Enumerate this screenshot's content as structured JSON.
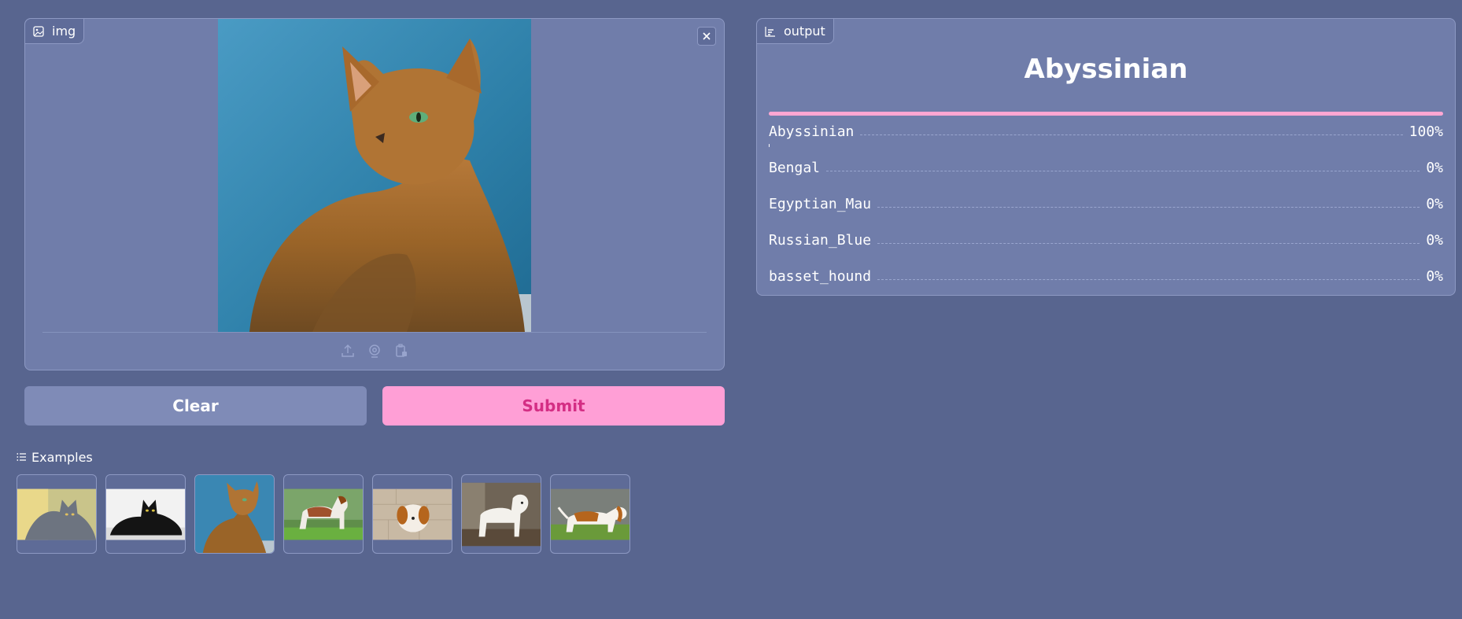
{
  "input": {
    "label": "img",
    "icon": "image-icon"
  },
  "buttons": {
    "clear": "Clear",
    "submit": "Submit"
  },
  "examples": {
    "label": "Examples",
    "items": [
      "russian-blue-cat-thumb",
      "black-cat-thumb",
      "abyssinian-cat-thumb",
      "saint-bernard-thumb",
      "shih-tzu-thumb",
      "white-dog-thumb",
      "basset-hound-thumb"
    ]
  },
  "output": {
    "label": "output",
    "title": "Abyssinian",
    "top_confidence": 1.0,
    "confidences": [
      {
        "label": "Abyssinian",
        "pct": "100%",
        "value": 1.0
      },
      {
        "label": "Bengal",
        "pct": "0%",
        "value": 0.0
      },
      {
        "label": "Egyptian_Mau",
        "pct": "0%",
        "value": 0.0
      },
      {
        "label": "Russian_Blue",
        "pct": "0%",
        "value": 0.0
      },
      {
        "label": "basset_hound",
        "pct": "0%",
        "value": 0.0
      }
    ]
  },
  "colors": {
    "background": "#58658f",
    "panel": "#707daa",
    "accent_pink": "#ffa6d2",
    "submit_text": "#d42e84"
  }
}
